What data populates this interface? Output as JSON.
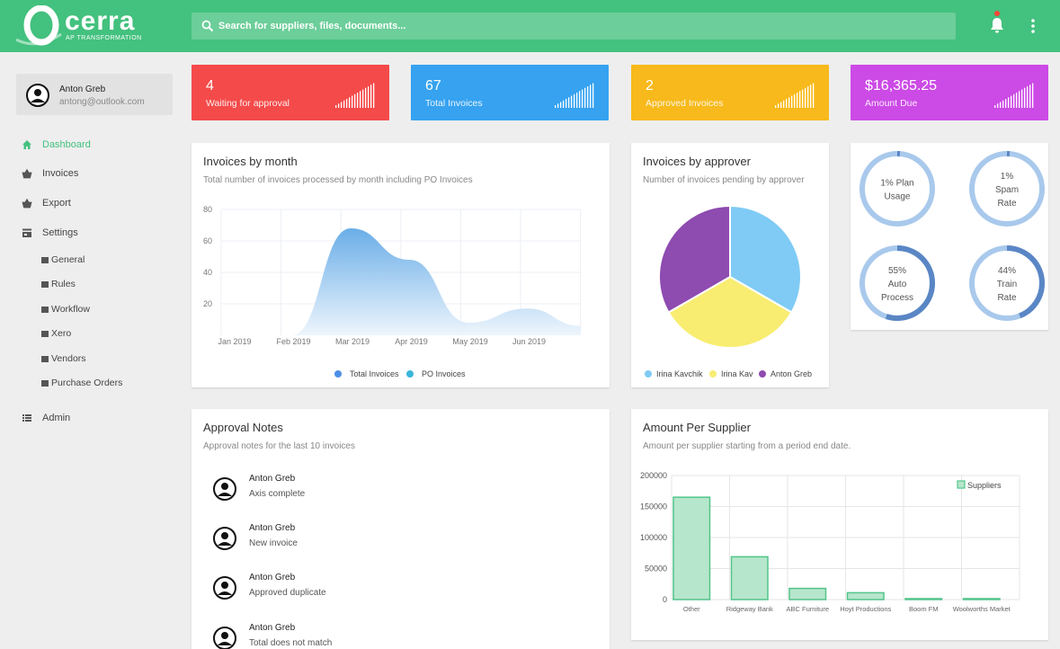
{
  "header": {
    "logo_word": "cerra",
    "logo_sub": "AP TRANSFORMATION",
    "search_placeholder": "Search for suppliers, files, documents..."
  },
  "user": {
    "name": "Anton Greb",
    "email": "antong@outlook.com"
  },
  "sidebar": {
    "items": [
      {
        "label": "Dashboard",
        "icon": "home-icon",
        "active": true
      },
      {
        "label": "Invoices",
        "icon": "basket-icon"
      },
      {
        "label": "Export",
        "icon": "basket-icon"
      },
      {
        "label": "Settings",
        "icon": "store-icon"
      }
    ],
    "settings_sub": [
      "General",
      "Rules",
      "Workflow",
      "Xero",
      "Vendors",
      "Purchase Orders"
    ],
    "admin": {
      "label": "Admin",
      "icon": "list-icon"
    }
  },
  "stats": [
    {
      "value": "4",
      "label": "Waiting for approval",
      "color": "#f44a4a"
    },
    {
      "value": "67",
      "label": "Total Invoices",
      "color": "#36a2f0"
    },
    {
      "value": "2",
      "label": "Approved Invoices",
      "color": "#f7b91b"
    },
    {
      "value": "$16,365.25",
      "label": "Amount Due",
      "color": "#cc4ae6"
    }
  ],
  "invoices_by_month": {
    "title": "Invoices by month",
    "subtitle": "Total number of invoices processed by month including PO Invoices",
    "legend": [
      "Total Invoices",
      "PO Invoices"
    ]
  },
  "invoices_by_approver": {
    "title": "Invoices by approver",
    "subtitle": "Number of invoices pending by approver",
    "legend": [
      "Irina Kavchik",
      "Irina Kav",
      "Anton Greb"
    ]
  },
  "gauges": [
    {
      "lines": [
        "1% Plan",
        "Usage"
      ],
      "percent": 1
    },
    {
      "lines": [
        "1%",
        "Spam",
        "Rate"
      ],
      "percent": 1
    },
    {
      "lines": [
        "55%",
        "Auto",
        "Process"
      ],
      "percent": 55
    },
    {
      "lines": [
        "44%",
        "Train",
        "Rate"
      ],
      "percent": 44
    }
  ],
  "approval_notes": {
    "title": "Approval Notes",
    "subtitle": "Approval notes for the last 10 invoices",
    "notes": [
      {
        "name": "Anton Greb",
        "text": "Axis complete"
      },
      {
        "name": "Anton Greb",
        "text": "New invoice"
      },
      {
        "name": "Anton Greb",
        "text": "Approved duplicate"
      },
      {
        "name": "Anton Greb",
        "text": "Total does not match"
      }
    ]
  },
  "amount_per_supplier": {
    "title": "Amount Per Supplier",
    "subtitle": "Amount per supplier starting from a period end date."
  },
  "chart_data": [
    {
      "type": "area",
      "x": [
        "Jan 2019",
        "Feb 2019",
        "Mar 2019",
        "Apr 2019",
        "May 2019",
        "Jun 2019"
      ],
      "series": [
        {
          "name": "Total Invoices",
          "values": [
            0,
            0,
            68,
            48,
            8,
            17
          ]
        },
        {
          "name": "PO Invoices",
          "values": [
            0,
            0,
            0,
            0,
            0,
            0
          ]
        }
      ],
      "yticks": [
        20,
        40,
        60,
        80
      ],
      "ylim": [
        0,
        80
      ],
      "grid": true,
      "legend": "bottom"
    },
    {
      "type": "pie",
      "categories": [
        "Irina Kavchik",
        "Irina Kav",
        "Anton Greb"
      ],
      "values": [
        1,
        1,
        1
      ],
      "colors": [
        "#7fcbf5",
        "#f8ed71",
        "#8e4bb0"
      ],
      "legend": "bottom"
    },
    {
      "type": "bar",
      "categories": [
        "Other",
        "Ridgeway Bank",
        "ABC Furniture",
        "Hoyt Productions",
        "Boom FM",
        "Woolworths Market"
      ],
      "series": [
        {
          "name": "Suppliers",
          "values": [
            165000,
            69000,
            18000,
            11000,
            1500,
            1500
          ]
        }
      ],
      "yticks": [
        0,
        50000,
        100000,
        150000,
        200000
      ],
      "ylim": [
        0,
        200000
      ],
      "grid": true,
      "legend": "top-right"
    }
  ]
}
